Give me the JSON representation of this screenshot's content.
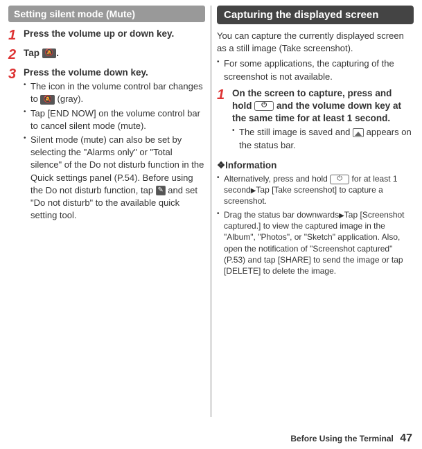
{
  "left": {
    "subheading": "Setting silent mode (Mute)",
    "step1": {
      "title": "Press the volume up or down key."
    },
    "step2": {
      "title_a": "Tap ",
      "title_b": "."
    },
    "step3": {
      "title": "Press the volume down key.",
      "b1a": "The icon in the volume control bar changes to ",
      "b1b": " (gray).",
      "b2": "Tap [END NOW] on the volume control bar to cancel silent mode (mute).",
      "b3a": "Silent mode (mute) can also be set by selecting the \"Alarms only\" or \"Total silence\" of the Do not disturb function in the Quick settings panel (P.54). Before using the Do not disturb function, tap ",
      "b3b": " and set \"Do not disturb\" to the available quick setting tool."
    }
  },
  "right": {
    "heading": "Capturing the displayed screen",
    "intro1": "You can capture the currently displayed screen as a still image (Take screenshot).",
    "intro2": "For some applications, the capturing of the screenshot is not available.",
    "step1": {
      "title_a": "On the screen to capture, press and hold ",
      "title_b": " and the volume down key at the same time for at least 1 second.",
      "b1a": "The still image is saved and ",
      "b1b": " appears on the status bar."
    },
    "info_head": "❖Information",
    "info1a": "Alternatively, press and hold ",
    "info1b": " for at least 1 second",
    "info1c": "Tap [Take screenshot] to capture a screenshot.",
    "info2a": "Drag the status bar downwards",
    "info2b": "Tap [Screenshot captured.] to view the captured image in the \"Album\", \"Photos\", or \"Sketch\" application. Also, open the notification of \"Screenshot captured\" (P.53) and tap [SHARE] to send the image or tap [DELETE] to delete the image."
  },
  "footer": {
    "section": "Before Using the Terminal",
    "page": "47"
  }
}
